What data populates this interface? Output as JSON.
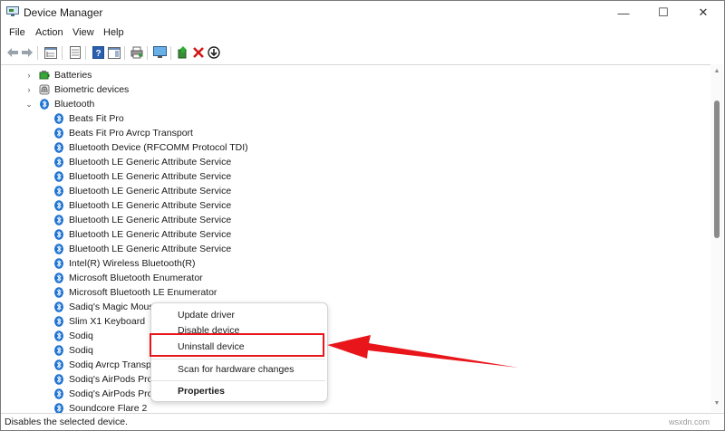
{
  "window": {
    "title": "Device Manager"
  },
  "controls": {
    "minimize": "—",
    "maximize": "☐",
    "close": "✕"
  },
  "menu": [
    "File",
    "Action",
    "View",
    "Help"
  ],
  "toolbar_icons": [
    "back-arrow-icon",
    "forward-arrow-icon",
    "console-tree-icon",
    "properties-icon",
    "help-icon",
    "action-pane-icon",
    "print-icon",
    "monitor-icon",
    "add-driver-icon",
    "uninstall-x-icon",
    "download-icon"
  ],
  "tree": {
    "categories": [
      {
        "label": "Batteries",
        "expanded": false
      },
      {
        "label": "Biometric devices",
        "expanded": false
      },
      {
        "label": "Bluetooth",
        "expanded": true
      }
    ],
    "bluetooth_devices": [
      "Beats Fit Pro",
      "Beats Fit Pro Avrcp Transport",
      "Bluetooth Device (RFCOMM Protocol TDI)",
      "Bluetooth LE Generic Attribute Service",
      "Bluetooth LE Generic Attribute Service",
      "Bluetooth LE Generic Attribute Service",
      "Bluetooth LE Generic Attribute Service",
      "Bluetooth LE Generic Attribute Service",
      "Bluetooth LE Generic Attribute Service",
      "Bluetooth LE Generic Attribute Service",
      "Intel(R) Wireless Bluetooth(R)",
      "Microsoft Bluetooth Enumerator",
      "Microsoft Bluetooth LE Enumerator",
      "Sadiq's Magic Mouse",
      "Slim X1 Keyboard",
      "Sodiq",
      "Sodiq",
      "Sodiq Avrcp Transpor",
      "Sodiq's AirPods Pro #",
      "Sodiq's AirPods Pro #",
      "Soundcore Flare 2"
    ]
  },
  "context_menu": {
    "items": [
      "Update driver",
      "Disable device",
      "Uninstall device",
      "Scan for hardware changes",
      "Properties"
    ],
    "highlighted": "Uninstall device"
  },
  "status": "Disables the selected device.",
  "watermark": "wsxdn.com",
  "colors": {
    "bluetooth": "#1e73d2",
    "callout": "#e8161b",
    "scroll_thumb": "#8a8a8a"
  }
}
